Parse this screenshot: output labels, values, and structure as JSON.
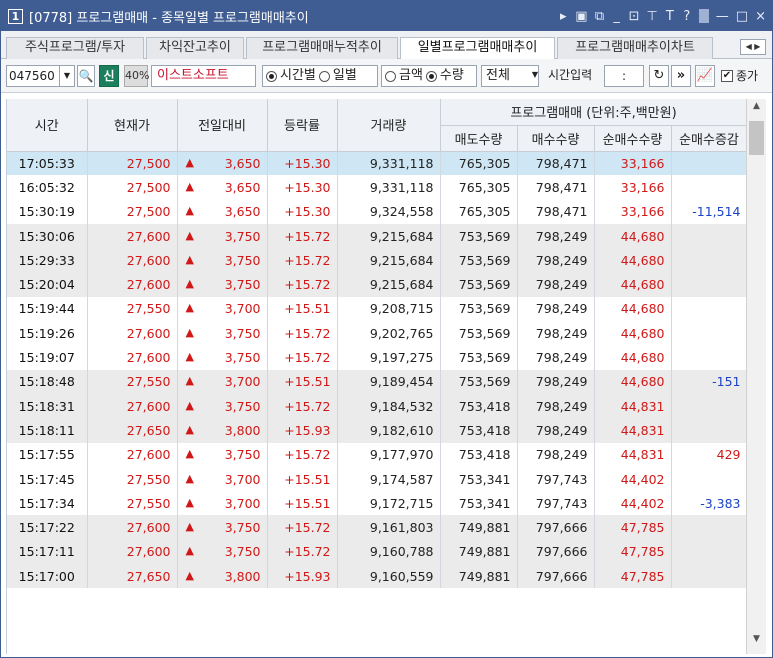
{
  "window": {
    "number": "1",
    "title": "[0778] 프로그램매매 - 종목일별 프로그램매매추이",
    "tb_icons": [
      "▸",
      "▣",
      "⧉",
      "_",
      "⊡",
      "⊤",
      "T",
      "?",
      "|",
      "—",
      "□",
      "×"
    ]
  },
  "tabs": [
    {
      "label": "주식프로그램/투자"
    },
    {
      "label": "차익잔고추이"
    },
    {
      "label": "프로그램매매누적추이"
    },
    {
      "label": "일별프로그램매매추이"
    },
    {
      "label": "프로그램매매추이차트"
    }
  ],
  "tab_nav": "◀ ▶",
  "toolbar": {
    "stock_code": "047560",
    "dropdown_glyph": "▼",
    "search_glyph": "🔍",
    "badge_new": "신",
    "badge_pct": "40%",
    "stock_name": "이스트소프트",
    "radio_timely": "시간별",
    "radio_daily": "일별",
    "radio_amount": "금액",
    "radio_qty": "수량",
    "scope": "전체",
    "time_label": "시간입력",
    "time_value": ":",
    "refresh_glyph": "↻",
    "next_glyph": "»",
    "chart_glyph": "📈",
    "close_check_label": "종가",
    "check_glyph": "✔"
  },
  "columns": {
    "time": "시간",
    "price": "현재가",
    "change": "전일대비",
    "rate": "등락률",
    "volume": "거래량",
    "group": "프로그램매매 (단위:주,백만원)",
    "sell": "매도수량",
    "buy": "매수수량",
    "net": "순매수수량",
    "net_delta": "순매수증감"
  },
  "up_arrow": "▲",
  "rows": [
    {
      "time": "17:05:33",
      "price": "27,500",
      "change": "3,650",
      "rate": "+15.30",
      "volume": "9,331,118",
      "sell": "765,305",
      "buy": "798,471",
      "net": "33,166",
      "delta": ""
    },
    {
      "time": "16:05:32",
      "price": "27,500",
      "change": "3,650",
      "rate": "+15.30",
      "volume": "9,331,118",
      "sell": "765,305",
      "buy": "798,471",
      "net": "33,166",
      "delta": ""
    },
    {
      "time": "15:30:19",
      "price": "27,500",
      "change": "3,650",
      "rate": "+15.30",
      "volume": "9,324,558",
      "sell": "765,305",
      "buy": "798,471",
      "net": "33,166",
      "delta": "-11,514"
    },
    {
      "time": "15:30:06",
      "price": "27,600",
      "change": "3,750",
      "rate": "+15.72",
      "volume": "9,215,684",
      "sell": "753,569",
      "buy": "798,249",
      "net": "44,680",
      "delta": ""
    },
    {
      "time": "15:29:33",
      "price": "27,600",
      "change": "3,750",
      "rate": "+15.72",
      "volume": "9,215,684",
      "sell": "753,569",
      "buy": "798,249",
      "net": "44,680",
      "delta": ""
    },
    {
      "time": "15:20:04",
      "price": "27,600",
      "change": "3,750",
      "rate": "+15.72",
      "volume": "9,215,684",
      "sell": "753,569",
      "buy": "798,249",
      "net": "44,680",
      "delta": ""
    },
    {
      "time": "15:19:44",
      "price": "27,550",
      "change": "3,700",
      "rate": "+15.51",
      "volume": "9,208,715",
      "sell": "753,569",
      "buy": "798,249",
      "net": "44,680",
      "delta": ""
    },
    {
      "time": "15:19:26",
      "price": "27,600",
      "change": "3,750",
      "rate": "+15.72",
      "volume": "9,202,765",
      "sell": "753,569",
      "buy": "798,249",
      "net": "44,680",
      "delta": ""
    },
    {
      "time": "15:19:07",
      "price": "27,600",
      "change": "3,750",
      "rate": "+15.72",
      "volume": "9,197,275",
      "sell": "753,569",
      "buy": "798,249",
      "net": "44,680",
      "delta": ""
    },
    {
      "time": "15:18:48",
      "price": "27,550",
      "change": "3,700",
      "rate": "+15.51",
      "volume": "9,189,454",
      "sell": "753,569",
      "buy": "798,249",
      "net": "44,680",
      "delta": "-151"
    },
    {
      "time": "15:18:31",
      "price": "27,600",
      "change": "3,750",
      "rate": "+15.72",
      "volume": "9,184,532",
      "sell": "753,418",
      "buy": "798,249",
      "net": "44,831",
      "delta": ""
    },
    {
      "time": "15:18:11",
      "price": "27,650",
      "change": "3,800",
      "rate": "+15.93",
      "volume": "9,182,610",
      "sell": "753,418",
      "buy": "798,249",
      "net": "44,831",
      "delta": ""
    },
    {
      "time": "15:17:55",
      "price": "27,600",
      "change": "3,750",
      "rate": "+15.72",
      "volume": "9,177,970",
      "sell": "753,418",
      "buy": "798,249",
      "net": "44,831",
      "delta": "429"
    },
    {
      "time": "15:17:45",
      "price": "27,550",
      "change": "3,700",
      "rate": "+15.51",
      "volume": "9,174,587",
      "sell": "753,341",
      "buy": "797,743",
      "net": "44,402",
      "delta": ""
    },
    {
      "time": "15:17:34",
      "price": "27,550",
      "change": "3,700",
      "rate": "+15.51",
      "volume": "9,172,715",
      "sell": "753,341",
      "buy": "797,743",
      "net": "44,402",
      "delta": "-3,383"
    },
    {
      "time": "15:17:22",
      "price": "27,600",
      "change": "3,750",
      "rate": "+15.72",
      "volume": "9,161,803",
      "sell": "749,881",
      "buy": "797,666",
      "net": "47,785",
      "delta": ""
    },
    {
      "time": "15:17:11",
      "price": "27,600",
      "change": "3,750",
      "rate": "+15.72",
      "volume": "9,160,788",
      "sell": "749,881",
      "buy": "797,666",
      "net": "47,785",
      "delta": ""
    },
    {
      "time": "15:17:00",
      "price": "27,650",
      "change": "3,800",
      "rate": "+15.93",
      "volume": "9,160,559",
      "sell": "749,881",
      "buy": "797,666",
      "net": "47,785",
      "delta": ""
    }
  ],
  "scroll_up": "▲",
  "scroll_down": "▼"
}
